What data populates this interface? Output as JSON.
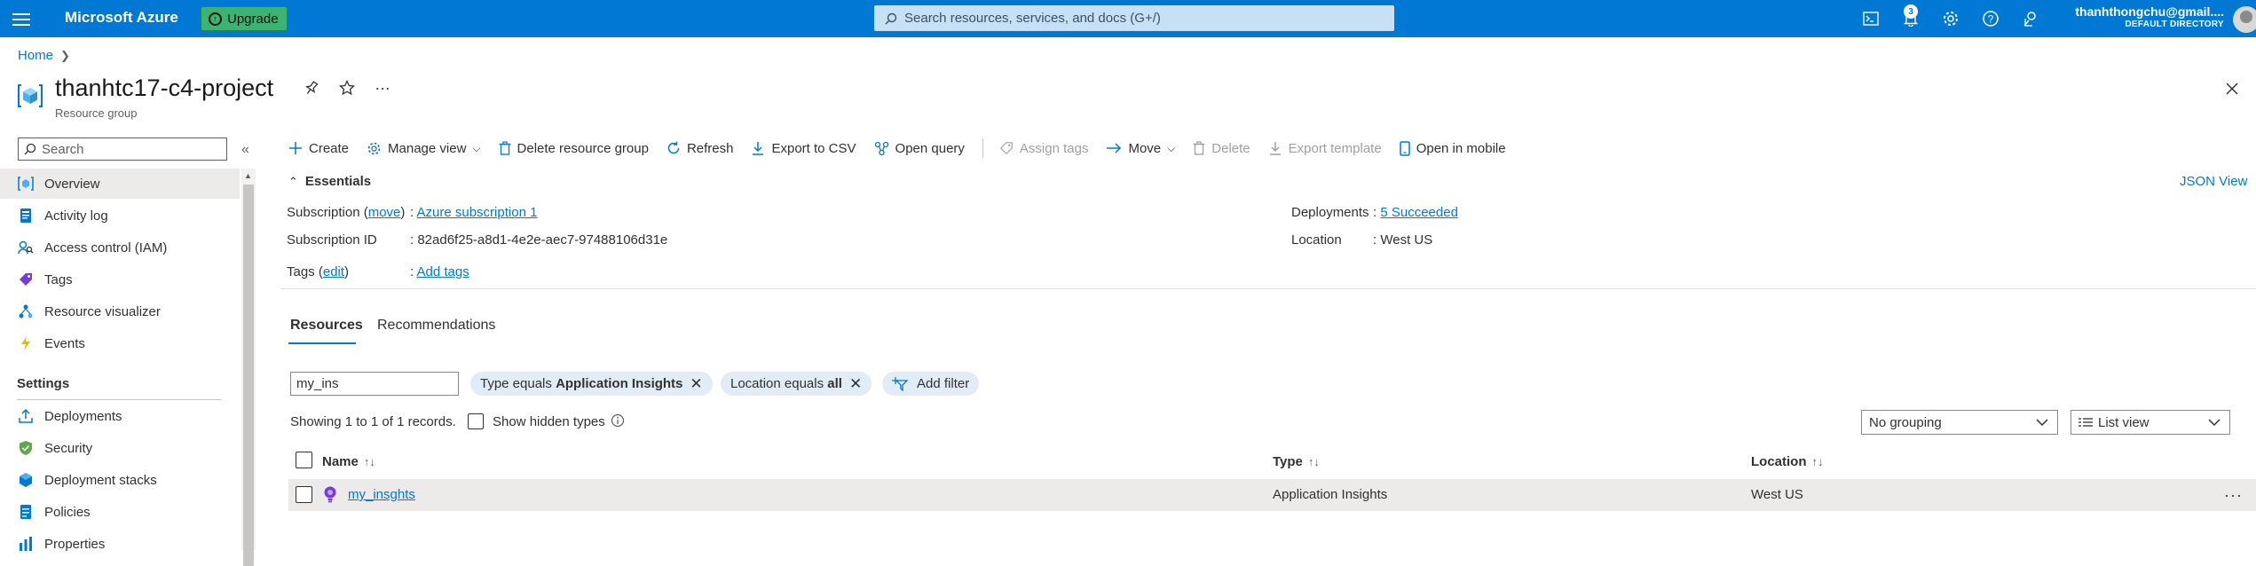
{
  "topbar": {
    "brand": "Microsoft Azure",
    "upgrade_label": "Upgrade",
    "search_placeholder": "Search resources, services, and docs (G+/)",
    "notification_count": "3",
    "user_email": "thanhthongchu@gmail....",
    "user_directory": "DEFAULT DIRECTORY"
  },
  "breadcrumb": {
    "home": "Home"
  },
  "header": {
    "title": "thanhtc17-c4-project",
    "subtitle": "Resource group"
  },
  "sidebar": {
    "search_placeholder": "Search",
    "items": [
      {
        "label": "Overview",
        "icon": "overview-icon"
      },
      {
        "label": "Activity log",
        "icon": "activity-log-icon"
      },
      {
        "label": "Access control (IAM)",
        "icon": "iam-icon"
      },
      {
        "label": "Tags",
        "icon": "tag-icon"
      },
      {
        "label": "Resource visualizer",
        "icon": "visualizer-icon"
      },
      {
        "label": "Events",
        "icon": "bolt-icon"
      }
    ],
    "settings_heading": "Settings",
    "settings_items": [
      {
        "label": "Deployments",
        "icon": "deployments-icon"
      },
      {
        "label": "Security",
        "icon": "shield-icon"
      },
      {
        "label": "Deployment stacks",
        "icon": "stacks-icon"
      },
      {
        "label": "Policies",
        "icon": "policy-icon"
      },
      {
        "label": "Properties",
        "icon": "properties-icon"
      }
    ]
  },
  "toolbar": {
    "create": "Create",
    "manage_view": "Manage view",
    "delete_rg": "Delete resource group",
    "refresh": "Refresh",
    "export_csv": "Export to CSV",
    "open_query": "Open query",
    "assign_tags": "Assign tags",
    "move": "Move",
    "delete": "Delete",
    "export_template": "Export template",
    "open_mobile": "Open in mobile"
  },
  "essentials": {
    "toggle_label": "Essentials",
    "json_view": "JSON View",
    "subscription_label": "Subscription",
    "subscription_move": "move",
    "subscription_value": "Azure subscription 1",
    "subscription_id_label": "Subscription ID",
    "subscription_id_value": "82ad6f25-a8d1-4e2e-aec7-97488106d31e",
    "tags_label": "Tags",
    "tags_edit": "edit",
    "tags_value": "Add tags",
    "deployments_label": "Deployments",
    "deployments_value": "5 Succeeded",
    "location_label": "Location",
    "location_value": "West US"
  },
  "tabs": {
    "resources": "Resources",
    "recommendations": "Recommendations"
  },
  "filters": {
    "text_filter": "my_ins",
    "type_filter_prefix": "Type equals",
    "type_filter_value": "Application Insights",
    "location_filter_prefix": "Location equals",
    "location_filter_value": "all",
    "add_filter": "Add filter"
  },
  "records_text": "Showing 1 to 1 of 1 records.",
  "show_hidden_types": "Show hidden types",
  "grouping": "No grouping",
  "view_mode": "List view",
  "table": {
    "headers": {
      "name": "Name",
      "type": "Type",
      "location": "Location"
    },
    "rows": [
      {
        "name": "my_insghts",
        "type": "Application Insights",
        "location": "West US"
      }
    ]
  }
}
